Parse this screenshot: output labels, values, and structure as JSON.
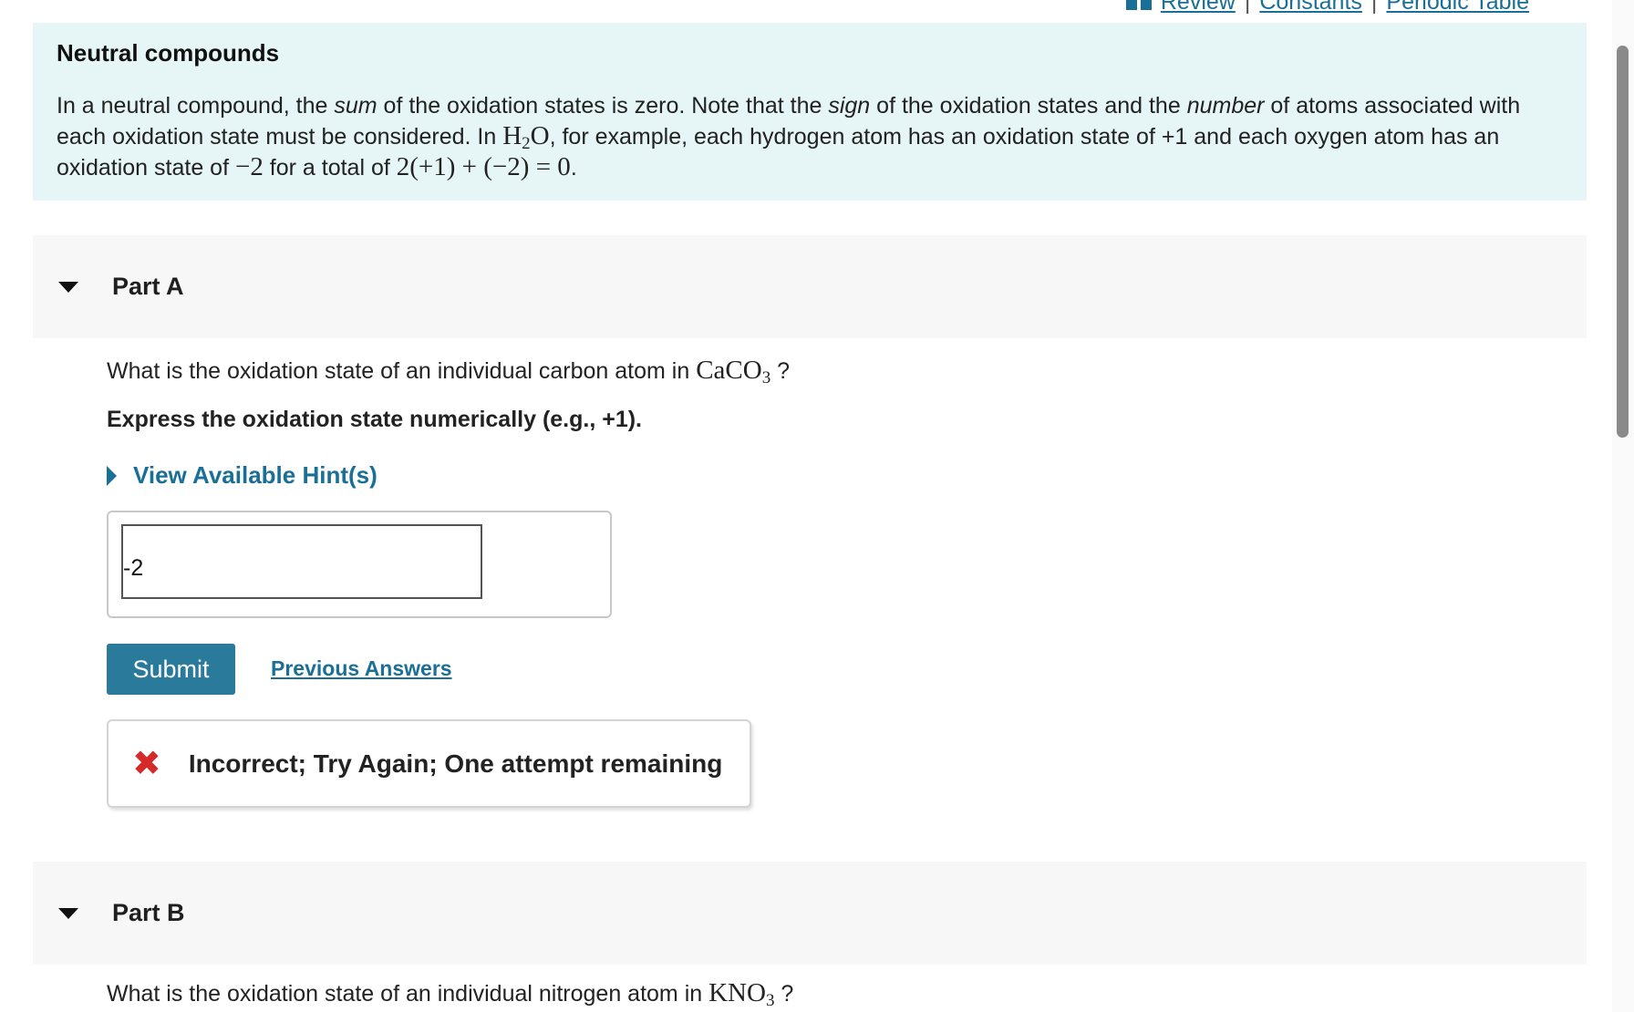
{
  "toplinks": {
    "review": "Review",
    "constants": "Constants",
    "periodic_table": "Periodic Table",
    "sep": "|"
  },
  "intro": {
    "title": "Neutral compounds",
    "t1": "In a neutral compound, the ",
    "sum": "sum",
    "t2": " of the oxidation states is zero. Note that the ",
    "sign": "sign",
    "t3": " of the oxidation states and the ",
    "number": "number",
    "t4": " of atoms associated with each oxidation state must be considered. In ",
    "h2o_h": "H",
    "h2o_2": "2",
    "h2o_o": "O",
    "t5": ", for example, each hydrogen atom has an oxidation state of +1 and each oxygen atom has an oxidation state of ",
    "minus2": "−2",
    "t6": " for a total of ",
    "total_expr": "2(+1) + (−2) = 0",
    "t7": "."
  },
  "partA": {
    "title": "Part A",
    "q_prefix": "What is the oxidation state of an individual carbon atom in ",
    "formula_main": "CaCO",
    "formula_sub": "3",
    "q_suffix": " ?",
    "instruction": "Express the oxidation state numerically (e.g., +1).",
    "hint": "View Available Hint(s)",
    "answer_value": "-2",
    "submit": "Submit",
    "previous": "Previous Answers",
    "feedback": "Incorrect; Try Again; One attempt remaining",
    "feedback_color": "#d42a2a"
  },
  "partB": {
    "title": "Part B",
    "q_prefix": "What is the oxidation state of an individual nitrogen atom in ",
    "formula_main": "KNO",
    "formula_sub": "3",
    "q_suffix": " ?"
  },
  "colors": {
    "accent": "#2a7a9c",
    "link": "#1a6f96",
    "intro_bg": "#e6f5f6"
  }
}
